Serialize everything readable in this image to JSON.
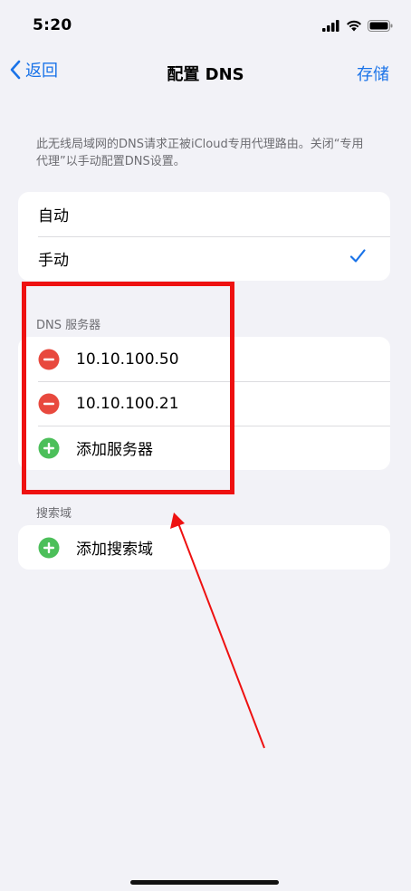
{
  "status": {
    "time": "5:20"
  },
  "nav": {
    "back_label": "返回",
    "title": "配置 DNS",
    "save_label": "存储"
  },
  "hint": "此无线局域网的DNS请求正被iCloud专用代理路由。关闭“专用代理”以手动配置DNS设置。",
  "mode": {
    "options": [
      "自动",
      "手动"
    ],
    "selected": "手动"
  },
  "dns_section": {
    "header": "DNS 服务器",
    "servers": [
      "10.10.100.50",
      "10.10.100.21"
    ],
    "add_label": "添加服务器"
  },
  "search_section": {
    "header": "搜索域",
    "add_label": "添加搜索域"
  },
  "colors": {
    "accent": "#1a73e8",
    "delete": "#e8493e",
    "add": "#4cbf5a",
    "annotation": "#ee1111"
  }
}
